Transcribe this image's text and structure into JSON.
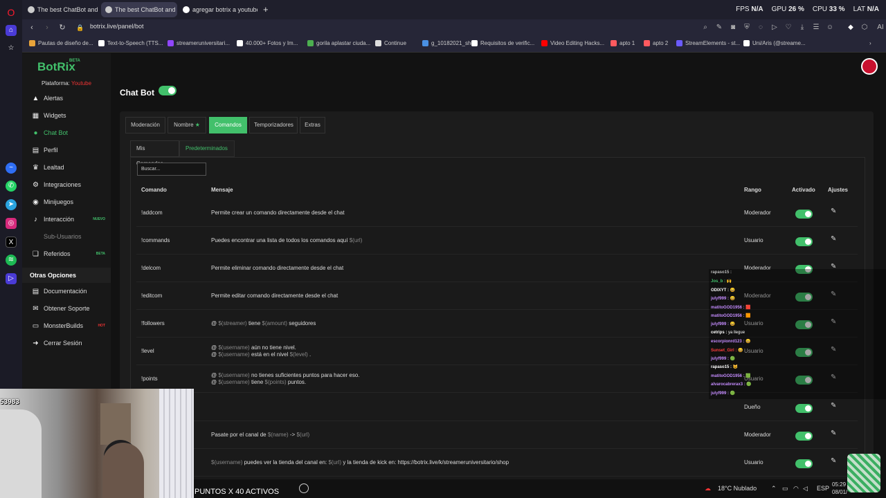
{
  "browser": {
    "tabs": [
      {
        "label": "The best ChatBot and Wi",
        "active": false
      },
      {
        "label": "The best ChatBot and Wi",
        "active": true
      },
      {
        "label": "agregar botrix a youtube",
        "active": false
      }
    ],
    "new_tab": "+",
    "url": "botrix.live/panel/bot",
    "perf": {
      "fps_label": "FPS",
      "fps": "N/A",
      "gpu_label": "GPU",
      "gpu": "26 %",
      "cpu_label": "CPU",
      "cpu": "33 %",
      "lat_label": "LAT",
      "lat": "N/A"
    },
    "ai_label": "AI",
    "bookmarks": [
      {
        "label": "Pautas de diseño de...",
        "color": "#e8a33a"
      },
      {
        "label": "Text-to-Speech (TTS...",
        "color": "#ffffff"
      },
      {
        "label": "streameruniversitari...",
        "color": "#9146ff"
      },
      {
        "label": "40.000+ Fotos y Im...",
        "color": "#ffffff"
      },
      {
        "label": "gorila aplastar ciuda...",
        "color": "#4caf50"
      },
      {
        "label": "Continue",
        "color": "#dddddd"
      },
      {
        "label": "g_10182021_shcc",
        "color": "#4a90e2"
      },
      {
        "label": "Requisitos de verific...",
        "color": "#ffffff"
      },
      {
        "label": "Video Editing Hacks...",
        "color": "#ff0000"
      },
      {
        "label": "apto 1",
        "color": "#ff5a5f"
      },
      {
        "label": "apto 2",
        "color": "#ff5a5f"
      },
      {
        "label": "StreamElements - st...",
        "color": "#6b5bff"
      },
      {
        "label": "Uni/Aris (@streame...",
        "color": "#ffffff"
      }
    ]
  },
  "app": {
    "logo": "BotRix",
    "logo_badge": "BETA",
    "platform_label": "Plataforma:",
    "platform_value": "Youtube",
    "nav": [
      {
        "label": "Alertas",
        "icon": "warning-icon",
        "glyph": "▲"
      },
      {
        "label": "Widgets",
        "icon": "widgets-icon",
        "glyph": "▦"
      },
      {
        "label": "Chat Bot",
        "icon": "robot-icon",
        "glyph": "●"
      },
      {
        "label": "Perfil",
        "icon": "profile-icon",
        "glyph": "▤"
      },
      {
        "label": "Lealtad",
        "icon": "trophy-icon",
        "glyph": "♛"
      },
      {
        "label": "Integraciones",
        "icon": "integrations-icon",
        "glyph": "⚙"
      },
      {
        "label": "Minijuegos",
        "icon": "gamepad-icon",
        "glyph": "◉"
      },
      {
        "label": "Interacción",
        "icon": "interaction-icon",
        "glyph": "♪",
        "badge": "NUEVO"
      },
      {
        "label": "Sub-Usuarios",
        "icon": "subusers-icon",
        "glyph": ""
      },
      {
        "label": "Referidos",
        "icon": "referrals-icon",
        "glyph": "❏",
        "badge": "BETA"
      }
    ],
    "other_header": "Otras Opciones",
    "other_nav": [
      {
        "label": "Documentación",
        "icon": "document-icon",
        "glyph": "▤"
      },
      {
        "label": "Obtener Soporte",
        "icon": "support-icon",
        "glyph": "✉"
      },
      {
        "label": "MonsterBuilds",
        "icon": "monitor-icon",
        "glyph": "▭",
        "badge": "HOT"
      },
      {
        "label": "Cerrar Sesión",
        "icon": "logout-icon",
        "glyph": "➜"
      }
    ],
    "title": "Chat Bot",
    "tabs": [
      {
        "label": "Moderación"
      },
      {
        "label": "Nombre"
      },
      {
        "label": "Comandos"
      },
      {
        "label": "Temporizadores"
      },
      {
        "label": "Extras"
      }
    ],
    "subtabs": [
      {
        "label": "Mis Comandos"
      },
      {
        "label": "Predeterminados"
      }
    ],
    "search_placeholder": "Buscar...",
    "columns": {
      "command": "Comando",
      "message": "Mensaje",
      "rank": "Rango",
      "active": "Activado",
      "settings": "Ajustes"
    },
    "rows": [
      {
        "command": "!addcom",
        "lines": [
          [
            {
              "t": "Permite crear un comando directamente desde el chat",
              "v": false
            }
          ]
        ],
        "rank": "Moderador",
        "enabled": true
      },
      {
        "command": "!commands",
        "lines": [
          [
            {
              "t": "Puedes encontrar una lista de todos los comandos aquí",
              "v": false
            },
            {
              "t": "$(url)",
              "v": true
            }
          ]
        ],
        "rank": "Usuario",
        "enabled": true
      },
      {
        "command": "!delcom",
        "lines": [
          [
            {
              "t": "Permite eliminar comando directamente desde el chat",
              "v": false
            }
          ]
        ],
        "rank": "Moderador",
        "enabled": true
      },
      {
        "command": "!editcom",
        "lines": [
          [
            {
              "t": "Permite editar comando directamente desde el chat",
              "v": false
            }
          ]
        ],
        "rank": "Moderador",
        "enabled": true
      },
      {
        "command": "!followers",
        "lines": [
          [
            {
              "t": "@",
              "v": false
            },
            {
              "t": "$(streamer)",
              "v": true
            },
            {
              "t": "tiene",
              "v": false
            },
            {
              "t": "$(amount)",
              "v": true
            },
            {
              "t": "seguidores",
              "v": false
            }
          ]
        ],
        "rank": "Usuario",
        "enabled": true
      },
      {
        "command": "!level",
        "lines": [
          [
            {
              "t": "@",
              "v": false
            },
            {
              "t": "$(username)",
              "v": true
            },
            {
              "t": "aún no tiene nivel.",
              "v": false
            }
          ],
          [
            {
              "t": "@",
              "v": false
            },
            {
              "t": "$(username)",
              "v": true
            },
            {
              "t": "está en el nivel",
              "v": false
            },
            {
              "t": "$(level)",
              "v": true
            },
            {
              "t": ".",
              "v": false
            }
          ]
        ],
        "rank": "Usuario",
        "enabled": true
      },
      {
        "command": "!points",
        "lines": [
          [
            {
              "t": "@",
              "v": false
            },
            {
              "t": "$(username)",
              "v": true
            },
            {
              "t": "no tienes suficientes puntos para hacer eso.",
              "v": false
            }
          ],
          [
            {
              "t": "@",
              "v": false
            },
            {
              "t": "$(username)",
              "v": true
            },
            {
              "t": "tiene",
              "v": false
            },
            {
              "t": "$(points)",
              "v": true
            },
            {
              "t": "puntos.",
              "v": false
            }
          ]
        ],
        "rank": "Usuario",
        "enabled": true
      },
      {
        "command": "",
        "lines": [],
        "rank": "Dueño",
        "enabled": true
      },
      {
        "command": "",
        "lines": [
          [
            {
              "t": "Pasate por el canal de",
              "v": false
            },
            {
              "t": "$(name)",
              "v": true
            },
            {
              "t": "->",
              "v": false
            },
            {
              "t": "$(url)",
              "v": true
            }
          ]
        ],
        "rank": "Moderador",
        "enabled": true
      },
      {
        "command": "",
        "lines": [
          [
            {
              "t": "$(username)",
              "v": true
            },
            {
              "t": "puedes ver la tienda del canal en:",
              "v": false
            },
            {
              "t": "$(url)",
              "v": true
            },
            {
              "t": "y la tienda de kick en: https://botrix.live/k/streameruniversitario/shop",
              "v": false
            }
          ]
        ],
        "rank": "Usuario",
        "enabled": true
      }
    ],
    "accent": "#42c06b"
  },
  "chat_overlay": [
    {
      "user": "rapaso15 :",
      "color": "#bbbbbb",
      "msg": ""
    },
    {
      "user": "Jos_b :",
      "color": "#42c06b",
      "msg": "🙌"
    },
    {
      "user": "ODIXYT :",
      "color": "#ffffff",
      "msg": "😀"
    },
    {
      "user": "julyf999 :",
      "color": "#c58cff",
      "msg": "😀"
    },
    {
      "user": "matitoGOD1956 :",
      "color": "#c58cff",
      "msg": "🟥"
    },
    {
      "user": "matitoGOD1956 :",
      "color": "#c58cff",
      "msg": "🟧"
    },
    {
      "user": "julyf999 :",
      "color": "#c58cff",
      "msg": "😀"
    },
    {
      "user": "cetrips :",
      "color": "#ffffff",
      "msg": "ya llegue"
    },
    {
      "user": "escorpionrd123 :",
      "color": "#c58cff",
      "msg": "😀"
    },
    {
      "user": "Sunset_Girl :",
      "color": "#ff3d3d",
      "msg": "😀"
    },
    {
      "user": "julyf999 :",
      "color": "#c58cff",
      "msg": "🟢"
    },
    {
      "user": "rapaso15 :",
      "color": "#ffffff",
      "msg": "😺"
    },
    {
      "user": "matitoGOD1956 :",
      "color": "#c58cff",
      "msg": "🟩"
    },
    {
      "user": "alvarocabrerax3 :",
      "color": "#c58cff",
      "msg": "🟢"
    },
    {
      "user": "julyf999 :",
      "color": "#c58cff",
      "msg": "🟢"
    }
  ],
  "webcam": {
    "counter": "53983"
  },
  "taskbar": {
    "overlay_text": "PUNTOS X 40 ACTIVOS",
    "weather": "18°C Nublado",
    "lang": "ESP",
    "time": "05:29",
    "date": "08/01/"
  }
}
